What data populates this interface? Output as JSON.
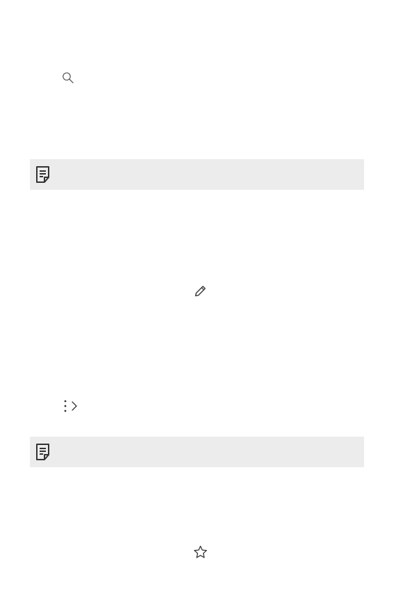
{
  "icons": {
    "search": "search-icon",
    "note": "note-icon",
    "edit": "pencil-icon",
    "more": "more-options-icon",
    "forward": "chevron-right-icon",
    "favorite": "star-icon"
  },
  "colors": {
    "note_background": "#ececec",
    "icon_stroke": "#333333"
  }
}
